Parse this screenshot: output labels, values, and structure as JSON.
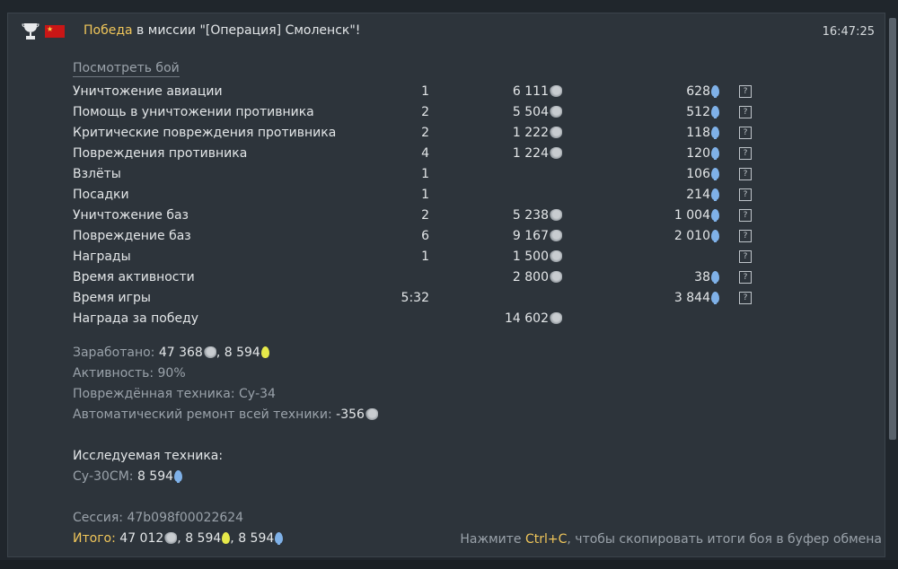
{
  "header": {
    "victory_word": "Победа",
    "mission_text": " в миссии \"[Операция] Смоленск\"!",
    "timestamp": "16:47:25"
  },
  "watch_battle": "Посмотреть бой",
  "rows": [
    {
      "label": "Уничтожение авиации",
      "count": "1",
      "lions": "6 111",
      "rp": "628"
    },
    {
      "label": "Помощь в уничтожении противника",
      "count": "2",
      "lions": "5 504",
      "rp": "512"
    },
    {
      "label": "Критические повреждения противника",
      "count": "2",
      "lions": "1 222",
      "rp": "118"
    },
    {
      "label": "Повреждения противника",
      "count": "4",
      "lions": "1 224",
      "rp": "120"
    },
    {
      "label": "Взлёты",
      "count": "1",
      "lions": "",
      "rp": "106"
    },
    {
      "label": "Посадки",
      "count": "1",
      "lions": "",
      "rp": "214"
    },
    {
      "label": "Уничтожение баз",
      "count": "2",
      "lions": "5 238",
      "rp": "1 004"
    },
    {
      "label": "Повреждение баз",
      "count": "6",
      "lions": "9 167",
      "rp": "2 010"
    },
    {
      "label": "Награды",
      "count": "1",
      "lions": "1 500",
      "rp": ""
    },
    {
      "label": "Время активности",
      "count": "",
      "lions": "2 800",
      "rp": "38"
    },
    {
      "label": "Время игры",
      "count": "5:32",
      "lions": "",
      "rp": "3 844"
    },
    {
      "label": "Награда за победу",
      "count": "",
      "lions": "14 602",
      "rp": "",
      "no_help": true
    }
  ],
  "help_glyph": "?",
  "summary": {
    "earned_label": "Заработано: ",
    "earned_lions": "47 368",
    "earned_sep": ", ",
    "earned_rp": "8 594",
    "activity": "Активность: 90%",
    "damaged": "Повреждённая техника: Су-34",
    "repair_label": "Автоматический ремонт всей техники: ",
    "repair_value": "-356",
    "research_title": "Исследуемая техника:",
    "research_vehicle": "Су-30СМ: ",
    "research_rp": "8 594",
    "session": "Сессия: 47b098f00022624",
    "total_label": "Итого: ",
    "total_lions": "47 012",
    "total_sep1": ", ",
    "total_rp1": "8 594",
    "total_sep2": ", ",
    "total_rp2": "8 594"
  },
  "hint": {
    "before": "Нажмите ",
    "keys": "Ctrl+C",
    "after": ", чтобы скопировать итоги боя в буфер обмена"
  },
  "colors": {
    "accent_gold": "#f0c65a",
    "rp_blue": "#7fb1e8",
    "rp_yellow": "#e6e94a",
    "panel_bg": "#2d343b"
  },
  "icons": [
    "trophy-icon",
    "ussr-flag-icon",
    "silver-lions-icon",
    "research-points-icon",
    "free-research-points-icon",
    "help-icon"
  ]
}
